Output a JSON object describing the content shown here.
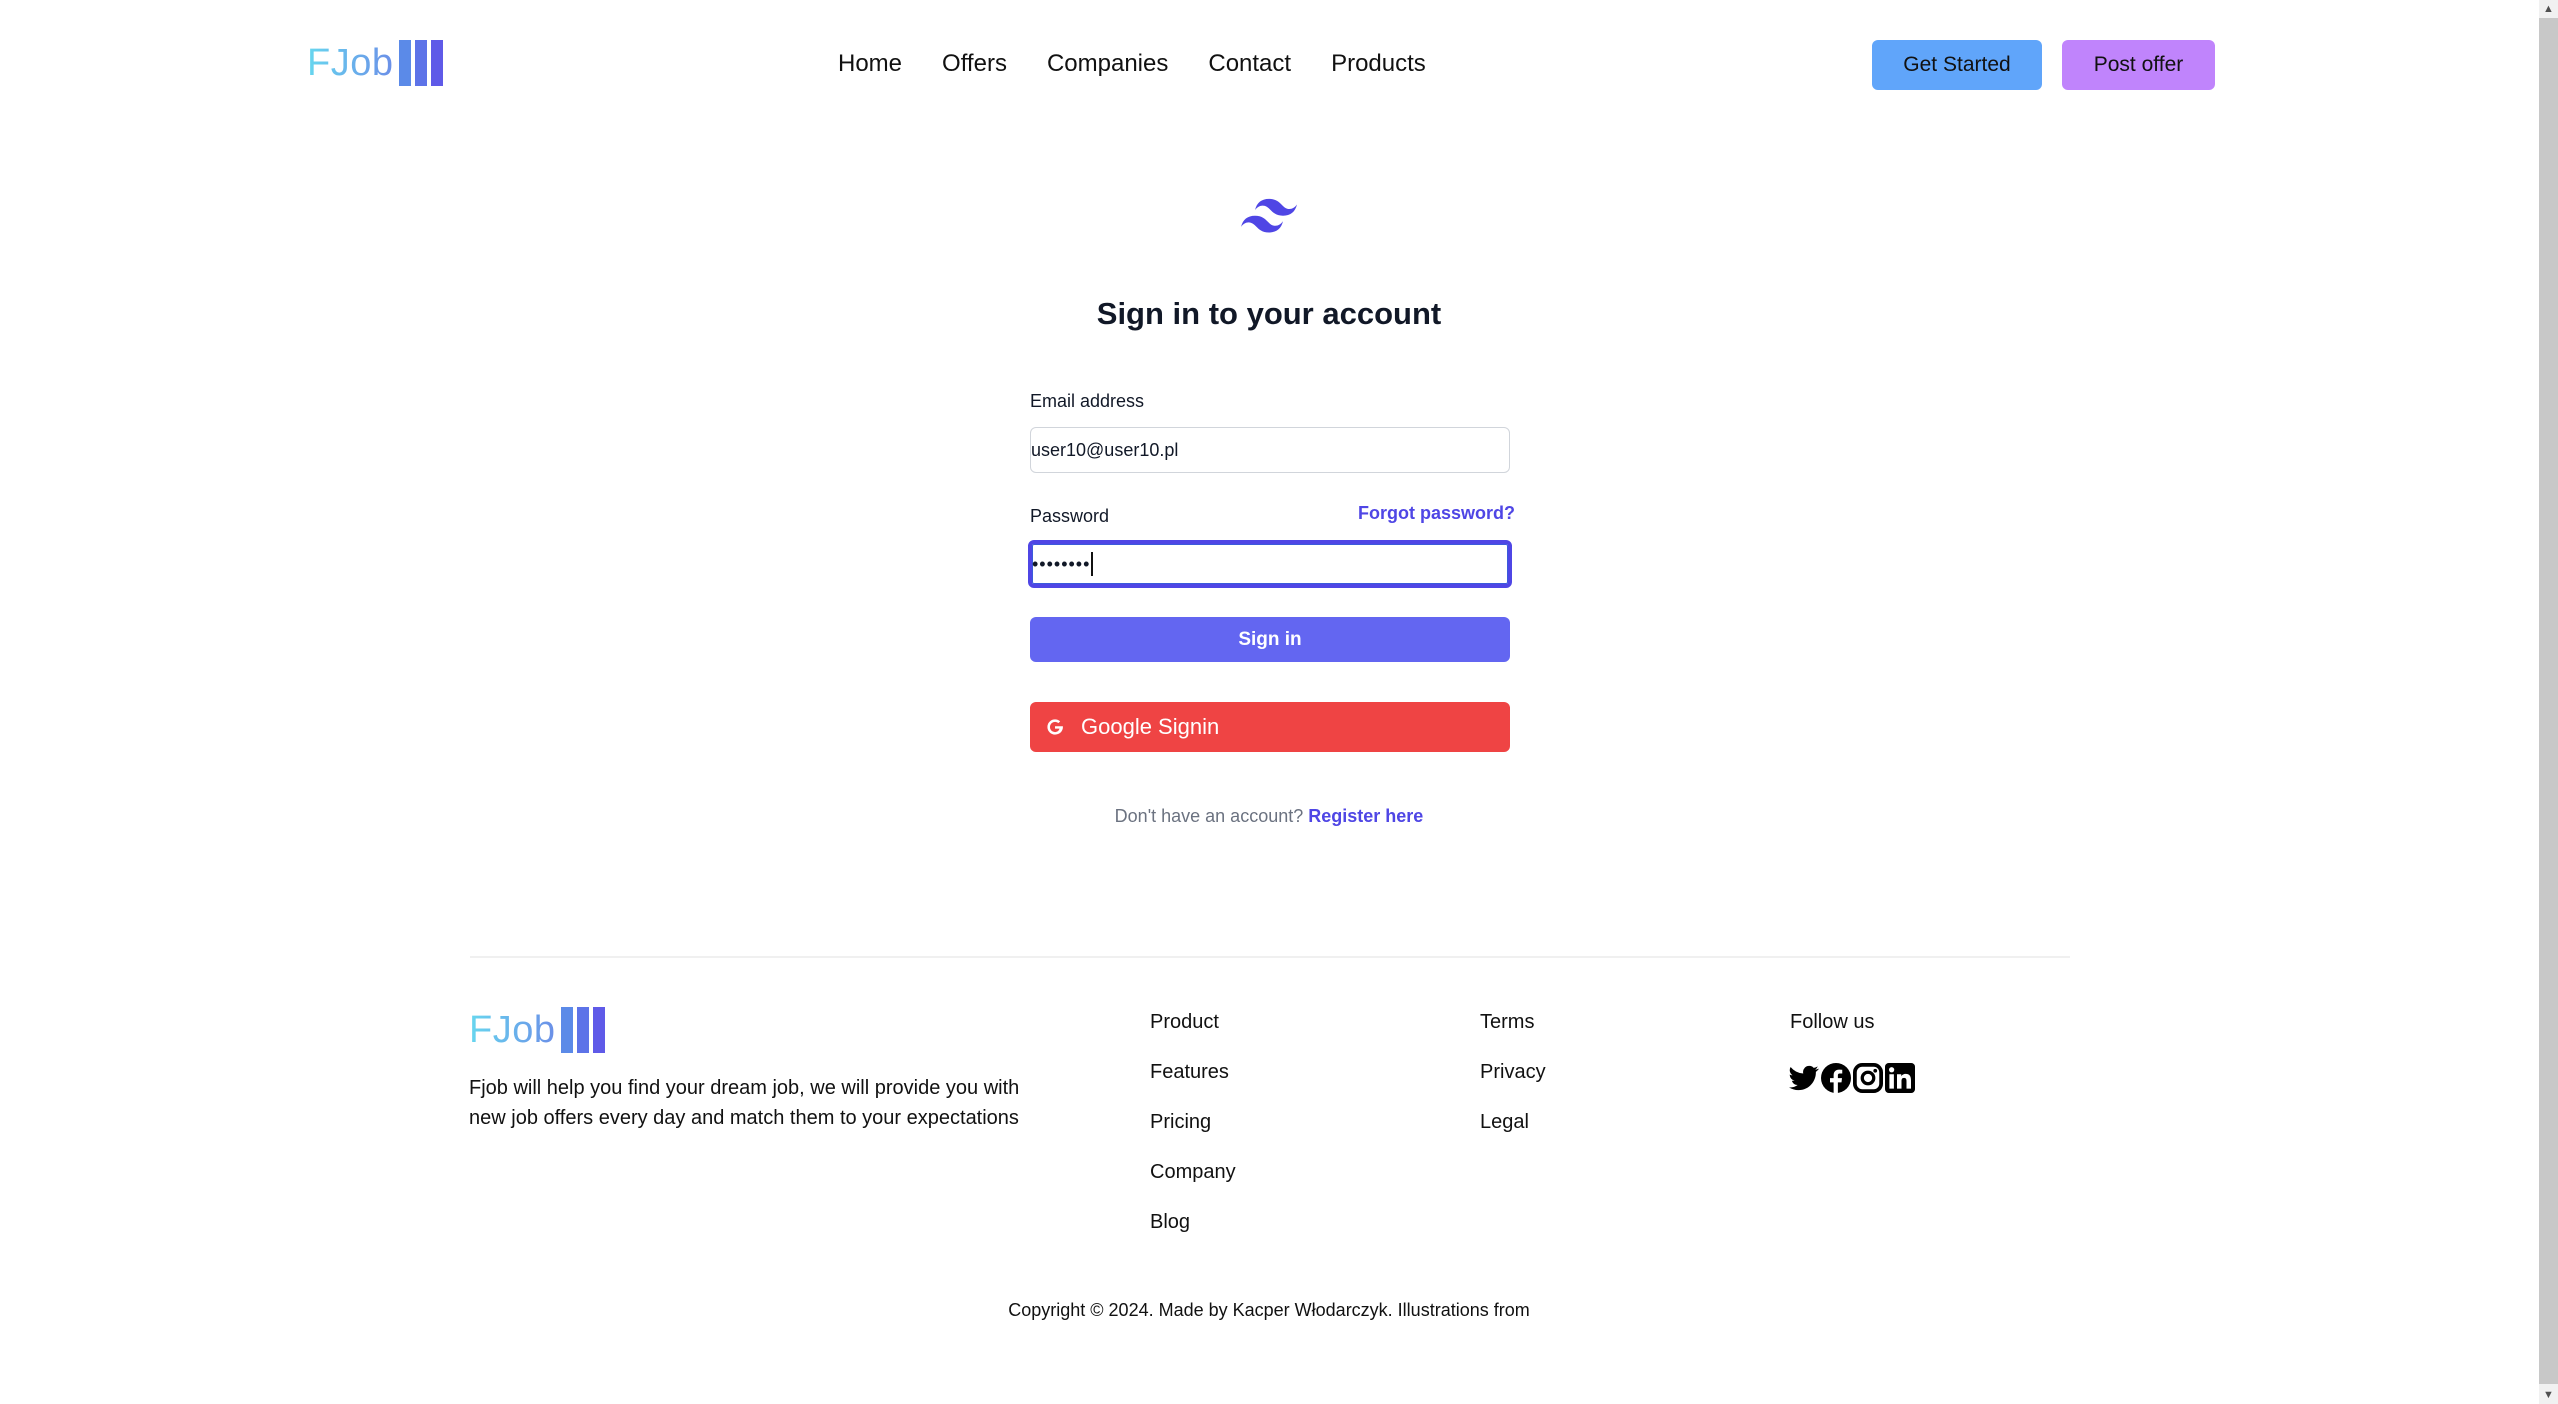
{
  "header": {
    "logo_text": "FJob",
    "nav": [
      "Home",
      "Offers",
      "Companies",
      "Contact",
      "Products"
    ],
    "get_started_label": "Get Started",
    "post_offer_label": "Post offer"
  },
  "colors": {
    "primary": "#6366f1",
    "link": "#4f46e5",
    "google": "#ef4444",
    "get_started_bg": "#60a5fa",
    "post_offer_bg": "#c084fc"
  },
  "signin": {
    "title": "Sign in to your account",
    "email_label": "Email address",
    "email_value": "user10@user10.pl",
    "password_label": "Password",
    "password_value": "••••••••",
    "forgot_label": "Forgot password?",
    "submit_label": "Sign in",
    "google_label": "Google Signin",
    "no_account_text": "Don't have an account?",
    "register_label": "Register here"
  },
  "footer": {
    "logo_text": "FJob",
    "description": "Fjob will help you find your dream job, we will provide you with new job offers every day and match them to your expectations",
    "col1": [
      "Product",
      "Features",
      "Pricing",
      "Company",
      "Blog"
    ],
    "col2": [
      "Terms",
      "Privacy",
      "Legal"
    ],
    "follow_label": "Follow us",
    "socials": [
      "twitter-icon",
      "facebook-icon",
      "instagram-icon",
      "linkedin-icon"
    ],
    "copyright": "Copyright © 2024. Made by Kacper Włodarczyk. Illustrations from"
  },
  "scrollbar": {
    "position_fraction": 0.0
  }
}
